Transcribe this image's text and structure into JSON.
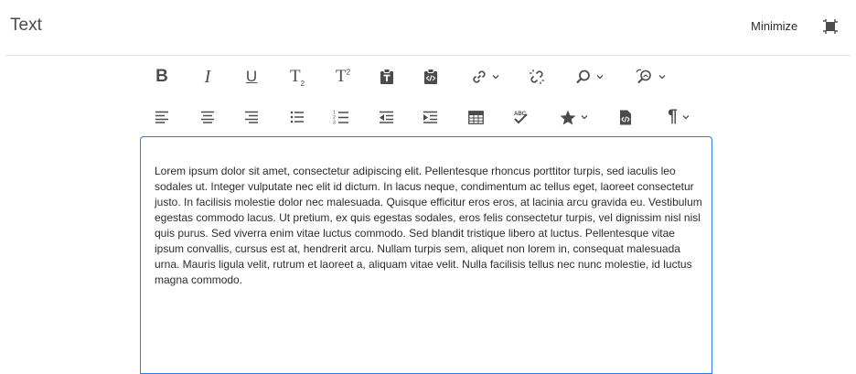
{
  "header": {
    "title": "Text",
    "minimize_label": "Minimize",
    "fullscreen_icon": "fullscreen-exit-icon"
  },
  "toolbar": {
    "row1": [
      {
        "name": "bold",
        "glyph": "B"
      },
      {
        "name": "italic",
        "glyph": "I"
      },
      {
        "name": "underline",
        "glyph": "U"
      },
      {
        "name": "subscript",
        "glyph": "T",
        "mark": "2"
      },
      {
        "name": "superscript",
        "glyph": "T",
        "mark": "2"
      },
      {
        "name": "paste-text",
        "icon": "paste-text-icon"
      },
      {
        "name": "paste-wordhtml",
        "icon": "paste-html-icon"
      },
      {
        "name": "link",
        "icon": "link-icon",
        "dropdown": true
      },
      {
        "name": "unlink",
        "icon": "unlink-icon"
      },
      {
        "name": "find",
        "icon": "search-icon",
        "dropdown": true
      },
      {
        "name": "find-replace",
        "icon": "find-replace-icon",
        "dropdown": true
      }
    ],
    "row2": [
      {
        "name": "align-left",
        "icon": "align-left-icon"
      },
      {
        "name": "align-center",
        "icon": "align-center-icon"
      },
      {
        "name": "align-right",
        "icon": "align-right-icon"
      },
      {
        "name": "bulleted-list",
        "icon": "bulleted-list-icon"
      },
      {
        "name": "numbered-list",
        "icon": "numbered-list-icon",
        "numbers": [
          "1",
          "2",
          "3"
        ]
      },
      {
        "name": "outdent",
        "icon": "outdent-icon"
      },
      {
        "name": "indent",
        "icon": "indent-icon"
      },
      {
        "name": "table",
        "icon": "table-icon"
      },
      {
        "name": "spellcheck",
        "icon": "spellcheck-icon",
        "label": "ABC"
      },
      {
        "name": "special-chars",
        "icon": "star-icon",
        "dropdown": true
      },
      {
        "name": "source-edit",
        "icon": "source-code-icon"
      },
      {
        "name": "paragraph-format",
        "glyph": "¶",
        "dropdown": true
      }
    ]
  },
  "editor": {
    "content": "Lorem ipsum dolor sit amet, consectetur adipiscing elit. Pellentesque rhoncus porttitor turpis, sed iaculis leo sodales ut. Integer vulputate nec elit id dictum. In lacus neque, condimentum ac tellus eget, laoreet consectetur justo. In facilisis molestie dolor nec malesuada. Quisque efficitur eros eros, at lacinia arcu gravida eu. Vestibulum egestas commodo lacus. Ut pretium, ex quis egestas sodales, eros felis consectetur turpis, vel dignissim nisl nisl quis purus. Sed viverra enim vitae luctus commodo. Sed blandit tristique libero at luctus. Pellentesque vitae ipsum convallis, cursus est at, hendrerit arcu. Nullam turpis sem, aliquet non lorem in, consequat malesuada urna. Mauris ligula velit, rutrum et laoreet a, aliquam vitae velit. Nulla facilisis tellus nec nunc molestie, id luctus magna commodo."
  },
  "colors": {
    "accent": "#2680eb",
    "icon": "#4b4b4b",
    "divider": "#e5e5e5"
  }
}
